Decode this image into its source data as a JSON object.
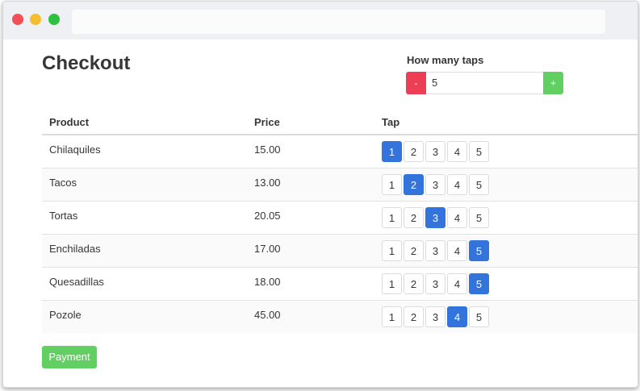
{
  "page": {
    "title": "Checkout"
  },
  "taps": {
    "label": "How many taps",
    "minus_label": "-",
    "plus_label": "+",
    "value": "5"
  },
  "table": {
    "headers": {
      "product": "Product",
      "price": "Price",
      "tap": "Tap"
    },
    "rows": [
      {
        "product": "Chilaquiles",
        "price": "15.00",
        "selected": 1
      },
      {
        "product": "Tacos",
        "price": "13.00",
        "selected": 2
      },
      {
        "product": "Tortas",
        "price": "20.05",
        "selected": 3
      },
      {
        "product": "Enchiladas",
        "price": "17.00",
        "selected": 5
      },
      {
        "product": "Quesadillas",
        "price": "18.00",
        "selected": 5
      },
      {
        "product": "Pozole",
        "price": "45.00",
        "selected": 4
      }
    ],
    "tap_options": [
      "1",
      "2",
      "3",
      "4",
      "5"
    ]
  },
  "payment": {
    "label": "Payment"
  },
  "colors": {
    "accent": "#3273dc",
    "success": "#62cf63",
    "danger": "#ee3e55"
  }
}
